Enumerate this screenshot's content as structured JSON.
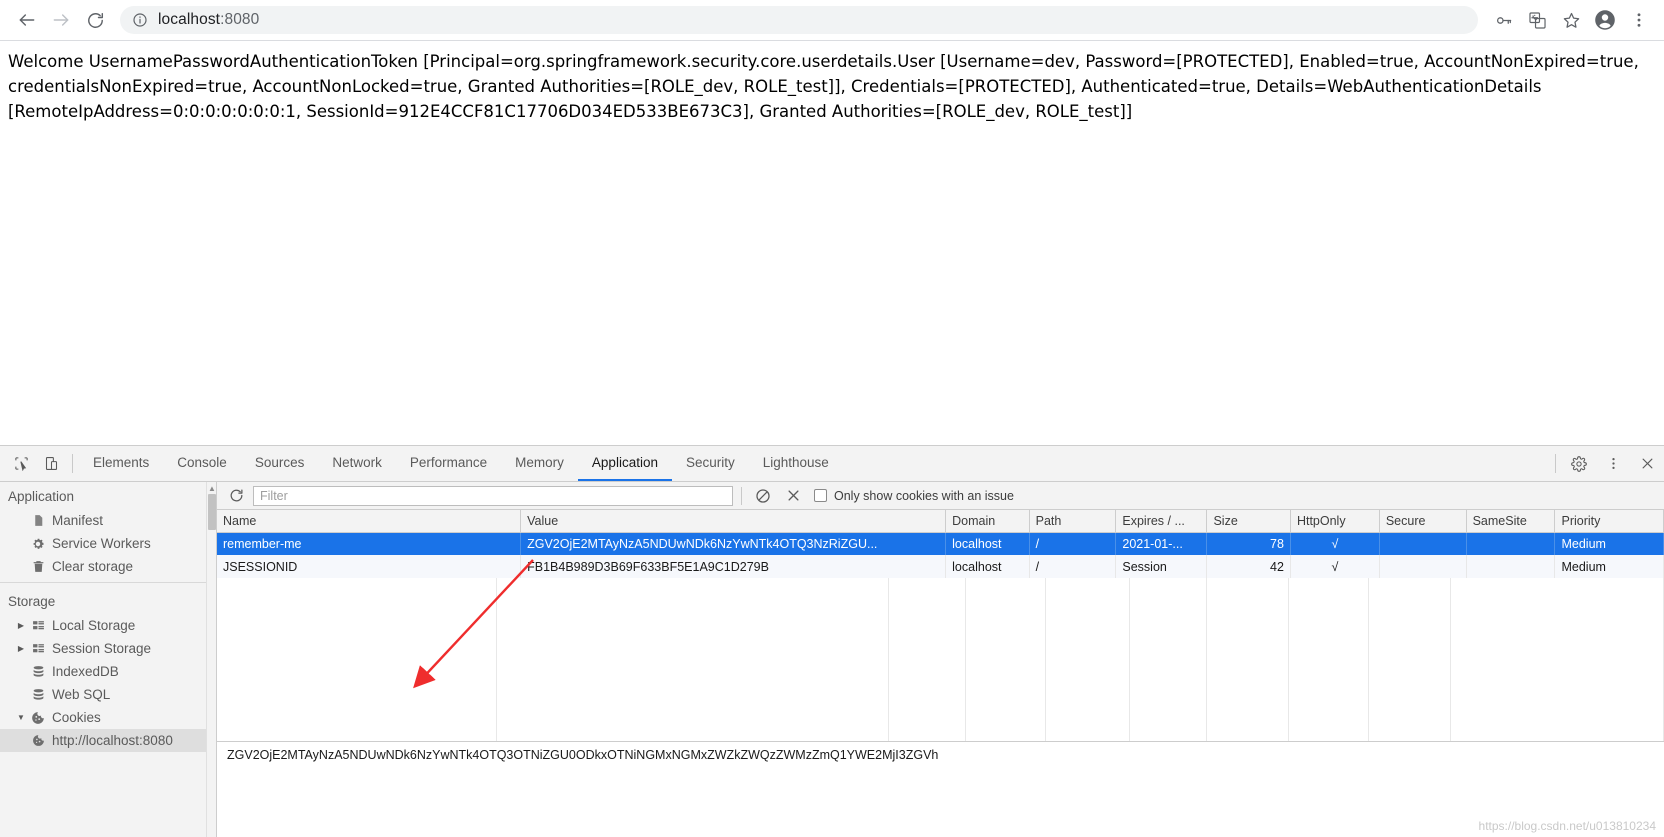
{
  "browser": {
    "back_label": "back-arrow",
    "forward_label": "forward-arrow",
    "reload_label": "reload",
    "url_host": "localhost",
    "url_port": ":8080",
    "site_info": "site-information",
    "icons": [
      "password-key-icon",
      "translate-icon",
      "bookmark-star-icon",
      "profile-avatar-icon",
      "more-menu-icon"
    ]
  },
  "page": {
    "body_text": "Welcome UsernamePasswordAuthenticationToken [Principal=org.springframework.security.core.userdetails.User [Username=dev, Password=[PROTECTED], Enabled=true, AccountNonExpired=true, credentialsNonExpired=true, AccountNonLocked=true, Granted Authorities=[ROLE_dev, ROLE_test]], Credentials=[PROTECTED], Authenticated=true, Details=WebAuthenticationDetails [RemoteIpAddress=0:0:0:0:0:0:0:1, SessionId=912E4CCF81C17706D034ED533BE673C3], Granted Authorities=[ROLE_dev, ROLE_test]]"
  },
  "devtools": {
    "inspect_icon": "inspect-element-icon",
    "device_icon": "device-toolbar-icon",
    "tabs": [
      {
        "label": "Elements",
        "active": false
      },
      {
        "label": "Console",
        "active": false
      },
      {
        "label": "Sources",
        "active": false
      },
      {
        "label": "Network",
        "active": false
      },
      {
        "label": "Performance",
        "active": false
      },
      {
        "label": "Memory",
        "active": false
      },
      {
        "label": "Application",
        "active": true
      },
      {
        "label": "Security",
        "active": false
      },
      {
        "label": "Lighthouse",
        "active": false
      }
    ],
    "settings_icon": "gear-icon",
    "more_icon": "more-vertical-icon",
    "close_icon": "close-icon",
    "sidebar": {
      "section_application": "Application",
      "application_items": [
        {
          "label": "Manifest",
          "icon": "document-icon"
        },
        {
          "label": "Service Workers",
          "icon": "gear-icon"
        },
        {
          "label": "Clear storage",
          "icon": "trash-icon"
        }
      ],
      "section_storage": "Storage",
      "storage_items": [
        {
          "label": "Local Storage",
          "icon": "table-icon",
          "arrow": "collapsed"
        },
        {
          "label": "Session Storage",
          "icon": "table-icon",
          "arrow": "collapsed"
        },
        {
          "label": "IndexedDB",
          "icon": "database-icon",
          "arrow": "none"
        },
        {
          "label": "Web SQL",
          "icon": "database-icon",
          "arrow": "none"
        },
        {
          "label": "Cookies",
          "icon": "cookie-icon",
          "arrow": "expanded"
        }
      ],
      "cookie_origin": {
        "label": "http://localhost:8080",
        "icon": "cookie-icon",
        "selected": true
      }
    },
    "toolbar": {
      "refresh_icon": "refresh-icon",
      "filter_placeholder": "Filter",
      "clear_all_icon": "clear-all-cookies-icon",
      "delete_icon": "delete-selected-cookie-icon",
      "issue_checkbox_label": "Only show cookies with an issue",
      "issue_checkbox_checked": false
    },
    "table": {
      "columns": [
        "Name",
        "Value",
        "Domain",
        "Path",
        "Expires / ...",
        "Size",
        "HttpOnly",
        "Secure",
        "SameSite",
        "Priority"
      ],
      "rows": [
        {
          "selected": true,
          "name": "remember-me",
          "value": "ZGV2OjE2MTAyNzA5NDUwNDk6NzYwNTk4OTQ3NzRiZGU...",
          "domain": "localhost",
          "path": "/",
          "expires": "2021-01-...",
          "size": "78",
          "httponly": "√",
          "secure": "",
          "samesite": "",
          "priority": "Medium"
        },
        {
          "selected": false,
          "name": "JSESSIONID",
          "value": "FB1B4B989D3B69F633BF5E1A9C1D279B",
          "domain": "localhost",
          "path": "/",
          "expires": "Session",
          "size": "42",
          "httponly": "√",
          "secure": "",
          "samesite": "",
          "priority": "Medium"
        }
      ]
    },
    "preview_value": "ZGV2OjE2MTAyNzA5NDUwNDk6NzYwNTk4OTQ3OTNiZGU0ODkxOTNiNGMxNGMxZWZkZWQzZWMzZmQ1YWE2MjI3ZGVh"
  },
  "watermark": "https://blog.csdn.net/u013810234"
}
